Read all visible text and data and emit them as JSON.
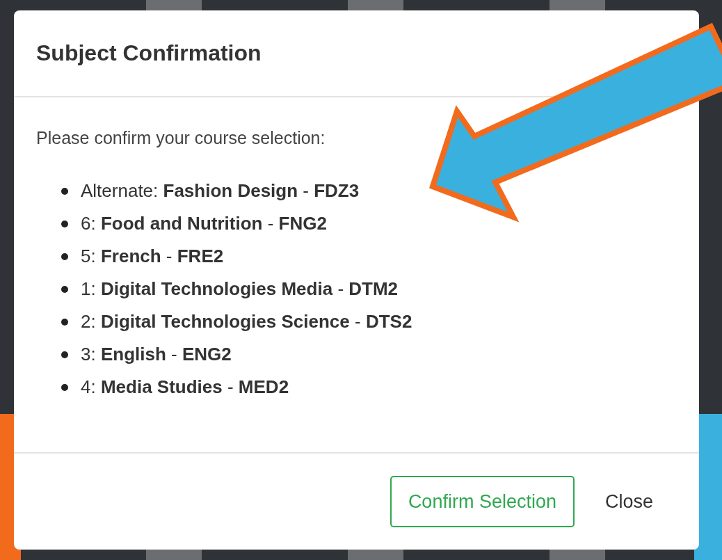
{
  "modal": {
    "title": "Subject Confirmation",
    "prompt": "Please confirm your course selection:",
    "courses": [
      {
        "text": "Alternate: **Fashion Design** - **FDZ3**"
      },
      {
        "text": "6: **Food and Nutrition** - **FNG2**"
      },
      {
        "text": "5: **French** - **FRE2**"
      },
      {
        "text": "1: **Digital Technologies Media** - **DTM2**"
      },
      {
        "text": "2: **Digital Technologies Science** - **DTS2**"
      },
      {
        "text": "3: **English** - **ENG2**"
      },
      {
        "text": "4: **Media Studies** - **MED2**"
      }
    ],
    "buttons": [
      {
        "label": "Confirm Selection",
        "kind": "primary"
      },
      {
        "label": "Close",
        "kind": "plain"
      }
    ]
  }
}
